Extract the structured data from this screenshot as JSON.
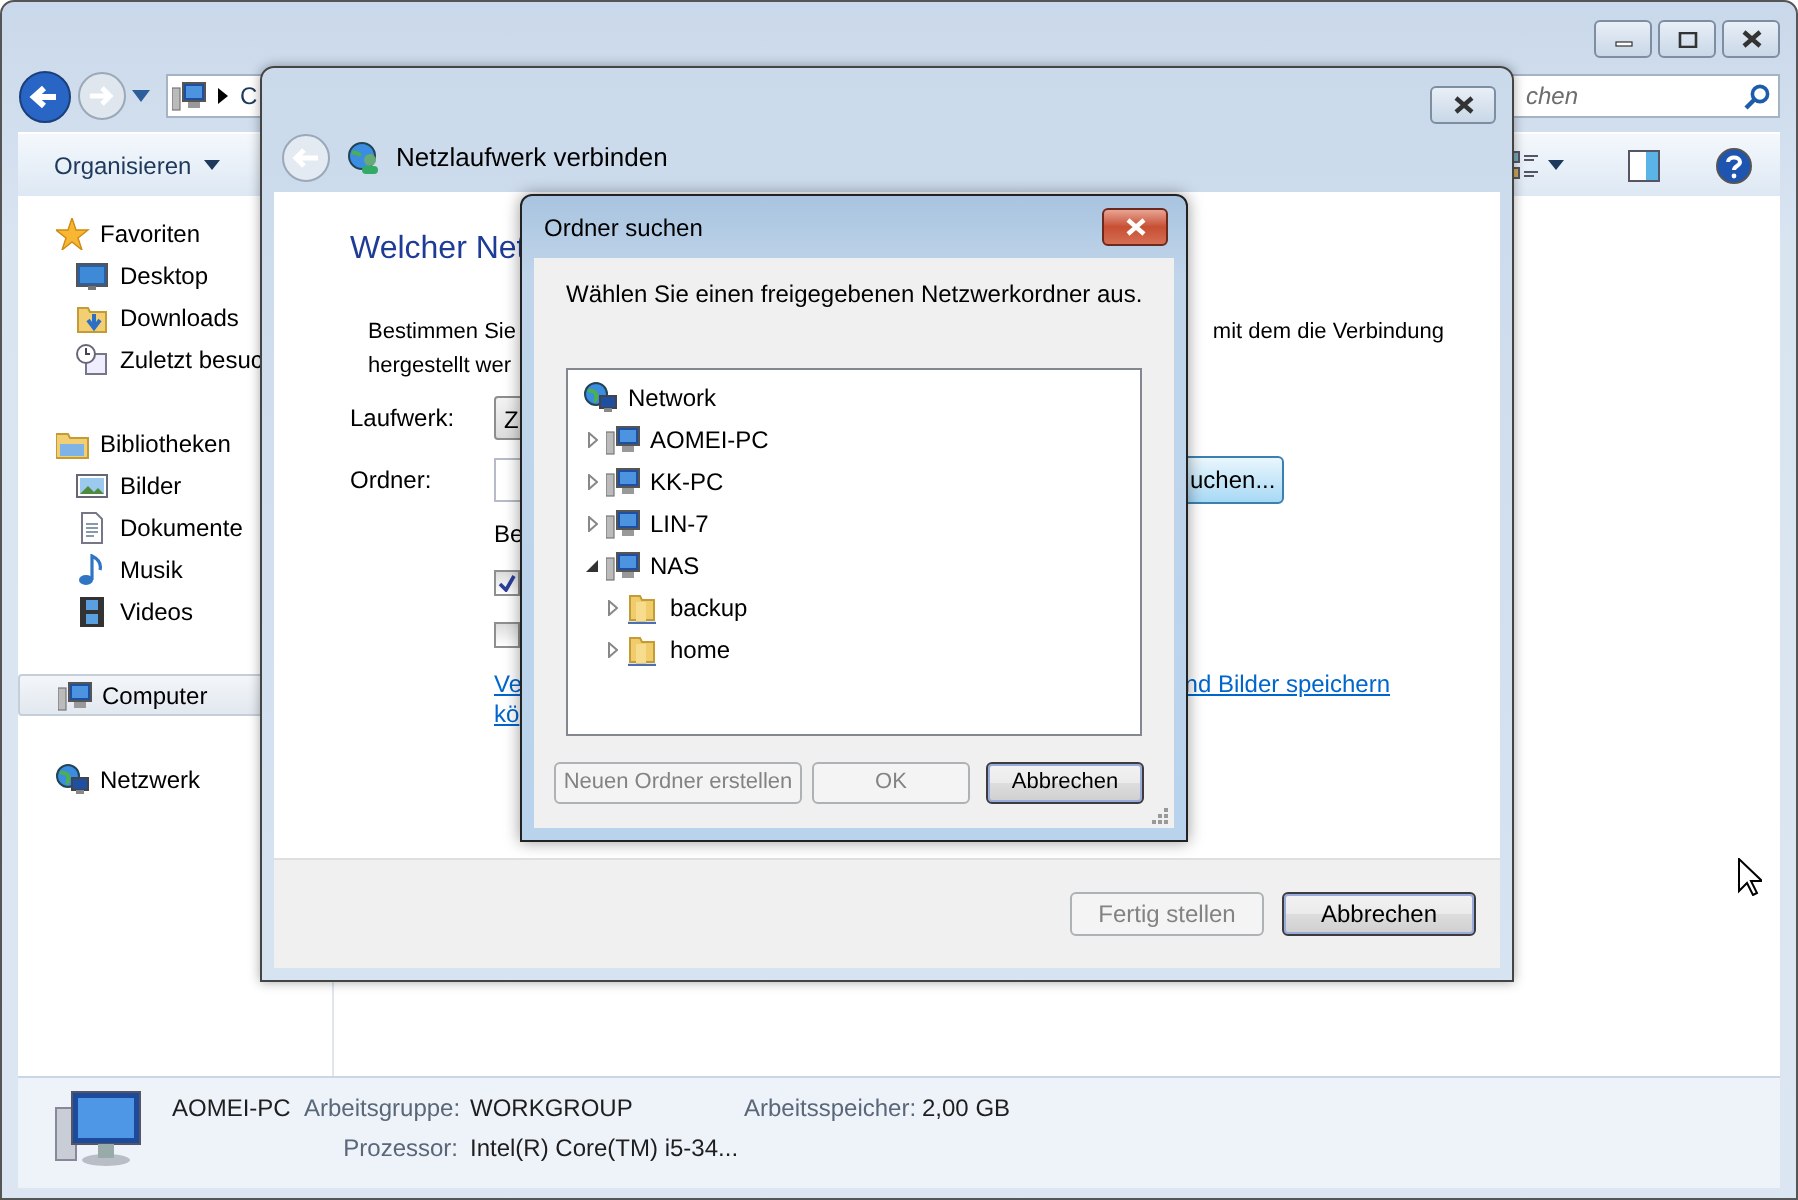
{
  "explorer": {
    "address_text": "C",
    "search_placeholder": "chen",
    "organize_label": "Organisieren",
    "sidebar": [
      {
        "label": "Favoriten",
        "kind": "favorites",
        "selected": false,
        "children": [
          {
            "label": "Desktop",
            "kind": "desktop",
            "selected": false
          },
          {
            "label": "Downloads",
            "kind": "downloads",
            "selected": false
          },
          {
            "label": "Zuletzt besuc",
            "kind": "recent",
            "selected": false
          }
        ]
      },
      {
        "label": "Bibliotheken",
        "kind": "libraries",
        "selected": false,
        "children": [
          {
            "label": "Bilder",
            "kind": "pictures",
            "selected": false
          },
          {
            "label": "Dokumente",
            "kind": "documents",
            "selected": false
          },
          {
            "label": "Musik",
            "kind": "music",
            "selected": false
          },
          {
            "label": "Videos",
            "kind": "videos",
            "selected": false
          }
        ]
      },
      {
        "label": "Computer",
        "kind": "computer",
        "selected": true
      },
      {
        "label": "Netzwerk",
        "kind": "network",
        "selected": false
      }
    ],
    "details": {
      "name": "AOMEI-PC",
      "fields": [
        {
          "label": "Arbeitsgruppe:",
          "value": "WORKGROUP"
        },
        {
          "label": "Arbeitsspeicher:",
          "value": "2,00 GB"
        },
        {
          "label": "Prozessor:",
          "value": "Intel(R) Core(TM) i5-34..."
        }
      ]
    }
  },
  "wizard": {
    "title": "Netzlaufwerk verbinden",
    "heading": "Welcher Net",
    "description": [
      {
        "left": "Bestimmen Sie",
        "right": "mit dem die Verbindung"
      },
      {
        "left": "hergestellt wer"
      }
    ],
    "drive": {
      "label": "Laufwerk:",
      "value": "Z"
    },
    "folder": {
      "label": "Ordner:",
      "browse_button": "uchen..."
    },
    "options_label": "Be",
    "checkboxes": [
      {
        "checked": true
      },
      {
        "checked": false
      }
    ],
    "link": {
      "left": [
        "Ve",
        "kö"
      ],
      "right": "nd Bilder speichern"
    },
    "buttons": [
      {
        "label": "Fertig stellen",
        "disabled": true,
        "default": false
      },
      {
        "label": "Abbrechen",
        "disabled": false,
        "default": true
      }
    ]
  },
  "folder_dialog": {
    "title": "Ordner suchen",
    "prompt": "Wählen Sie einen freigegebenen Netzwerkordner aus.",
    "tree": [
      {
        "label": "Network",
        "kind": "network",
        "children": [
          {
            "label": "AOMEI-PC",
            "kind": "computer",
            "expanded": false
          },
          {
            "label": "KK-PC",
            "kind": "computer",
            "expanded": false
          },
          {
            "label": "LIN-7",
            "kind": "computer",
            "expanded": false
          },
          {
            "label": "NAS",
            "kind": "computer",
            "expanded": true,
            "children": [
              {
                "label": "backup",
                "kind": "share",
                "expanded": false
              },
              {
                "label": "home",
                "kind": "share",
                "expanded": false
              }
            ]
          }
        ]
      }
    ],
    "buttons": [
      {
        "label": "Neuen Ordner erstellen",
        "disabled": true,
        "default": false
      },
      {
        "label": "OK",
        "disabled": true,
        "default": false
      },
      {
        "label": "Abbrechen",
        "disabled": false,
        "default": true
      }
    ]
  }
}
